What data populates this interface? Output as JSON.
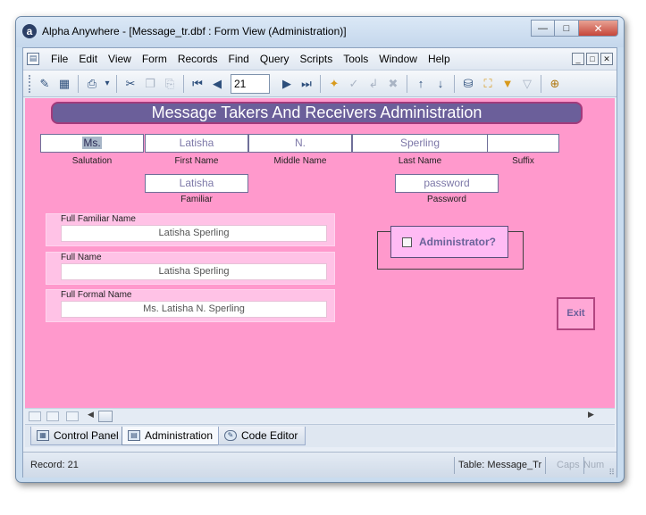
{
  "window": {
    "title": "Alpha Anywhere - [Message_tr.dbf : Form View (Administration)]",
    "app_icon_glyph": "a",
    "controls": {
      "minimize": "—",
      "maximize": "□",
      "close": "✕"
    }
  },
  "menubar": {
    "items": [
      "File",
      "Edit",
      "View",
      "Form",
      "Records",
      "Find",
      "Query",
      "Scripts",
      "Tools",
      "Window",
      "Help"
    ],
    "mdi_controls": [
      "_",
      "□",
      "✕"
    ]
  },
  "toolbar": {
    "record_number": "21",
    "icons": {
      "edit": "✎",
      "table": "▦",
      "print": "⎙",
      "dropdown": "▾",
      "cut": "✂",
      "copy": "❐",
      "paste": "⎘",
      "first": "⏮",
      "prev": "◀",
      "next": "▶",
      "last": "⏭",
      "new_record": "✦",
      "save_edit": "✓",
      "enter": "↲",
      "cancel": "✖",
      "sort_asc": "↑",
      "sort_desc": "↓",
      "query": "⛁",
      "search": "⛶",
      "filter": "▼",
      "clear_filter": "▽",
      "zoom": "⊕"
    }
  },
  "form": {
    "header": "Message Takers And Receivers Administration",
    "salutation": {
      "value": "Ms.",
      "label": "Salutation"
    },
    "first_name": {
      "value": "Latisha",
      "label": "First Name"
    },
    "middle_name": {
      "value": "N.",
      "label": "Middle Name"
    },
    "last_name": {
      "value": "Sperling",
      "label": "Last Name"
    },
    "suffix": {
      "value": "",
      "label": "Suffix"
    },
    "familiar": {
      "value": "Latisha",
      "label": "Familiar"
    },
    "password": {
      "value": "password",
      "label": "Password"
    },
    "full_familiar_name": {
      "label": "Full Familiar Name",
      "value": "Latisha Sperling"
    },
    "full_name": {
      "label": "Full Name",
      "value": "Latisha Sperling"
    },
    "full_formal_name": {
      "label": "Full Formal Name",
      "value": "Ms. Latisha N. Sperling"
    },
    "administrator": {
      "label": "Administrator?",
      "checked": false
    },
    "exit_label": "Exit"
  },
  "tabs": [
    {
      "label": "Control Panel",
      "active": false
    },
    {
      "label": "Administration",
      "active": true
    },
    {
      "label": "Code Editor",
      "active": false
    }
  ],
  "statusbar": {
    "record": "Record: 21",
    "table": "Table: Message_Tr",
    "caps": "Caps",
    "num": "Num"
  },
  "colors": {
    "form_background": "#ff99cc",
    "header_fill": "#6b5f9a",
    "header_border": "#a23a7b",
    "group_fill": "#ffc2e6",
    "admin_fill": "#ffbbf4",
    "field_text": "#7d78a8"
  }
}
